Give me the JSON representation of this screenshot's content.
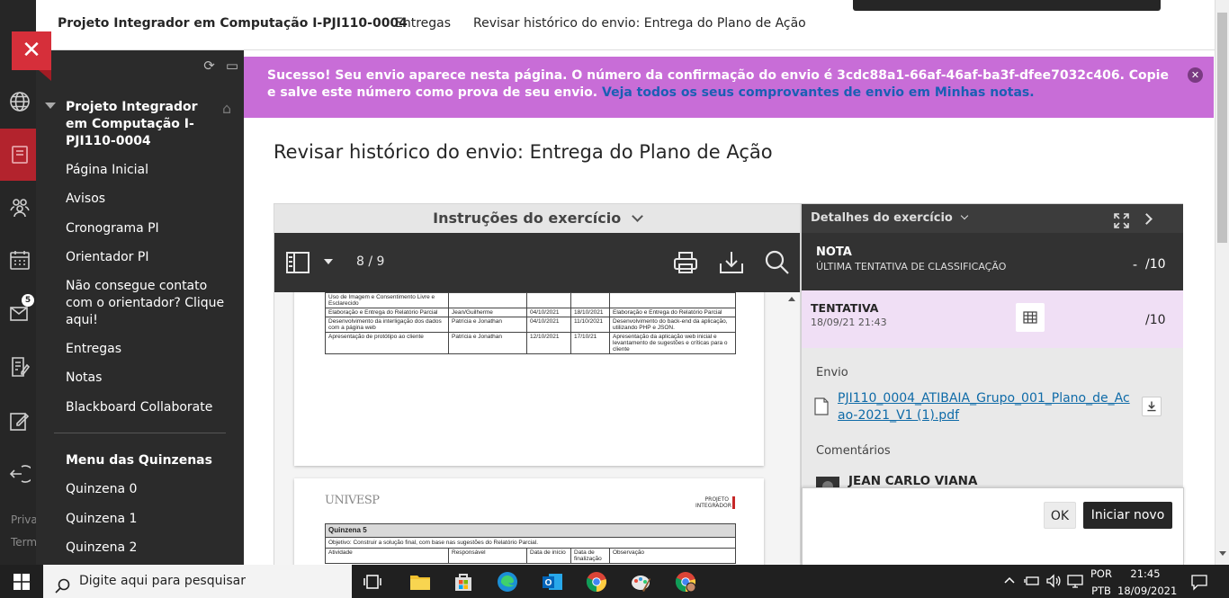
{
  "header": {
    "course": "Projeto Integrador em Computação I-PJI110-0004",
    "crumb_deliveries": "Entregas",
    "crumb_current": "Revisar histórico do envio: Entrega do Plano de Ação"
  },
  "rail": {
    "footer_1": "Priva",
    "footer_2": "Term",
    "mail_badge": "5"
  },
  "sidebar": {
    "course_title": "Projeto Integrador em Computação I-PJI110-0004",
    "items": [
      "Página Inicial",
      "Avisos",
      "Cronograma PI",
      "Orientador PI",
      "Não consegue contato com o orientador? Clique aqui!",
      "Entregas",
      "Notas",
      "Blackboard Collaborate"
    ],
    "section_title": "Menu das Quinzenas",
    "section_items": [
      "Quinzena 0",
      "Quinzena 1",
      "Quinzena 2"
    ]
  },
  "banner": {
    "text": "Sucesso! Seu envio aparece nesta página. O número da confirmação do envio é 3cdc88a1-66af-46af-ba3f-dfee7032c406. Copie e salve este número como prova de seu envio. ",
    "link": "Veja todos os seus comprovantes de envio em Minhas notas."
  },
  "page": {
    "title": "Revisar histórico do envio: Entrega do Plano de Ação"
  },
  "instructions": {
    "header": "Instruções do exercício"
  },
  "pdf": {
    "page_indicator": "8 / 9",
    "rows_top": [
      [
        "Uso de Imagem e Consentimento Livre e Esclarecido",
        "",
        "",
        "",
        ""
      ],
      [
        "Elaboração e Entrega do Relatório Parcial",
        "Jean/Guilherme",
        "04/10/2021",
        "18/10/2021",
        "Elaboração e Entrega do Relatório Parcial"
      ],
      [
        "Desenvolvimento da interligação dos dados com a página web",
        "Patrícia e Jonathan",
        "04/10/2021",
        "11/10/2021",
        "Desenvolvimento do back-end da aplicação, utilizando PHP e JSON."
      ],
      [
        "Apresentação de protótipo ao cliente",
        "Patrícia e Jonathan",
        "12/10/2021",
        "17/10/21",
        "Apresentação da aplicação web inicial e levantamento de sugestões e críticas para o cliente"
      ]
    ],
    "logo": "UNIVESP",
    "logo_right": "PROJETO INTEGRADOR",
    "q_title": "Quinzena 5",
    "q_objective": "Objetivo: Construir a solução final, com base nas sugestões do Relatório Parcial.",
    "q_col_activity": "Atividade",
    "q_col_responsible": "Responsável",
    "q_col_start": "Data de início",
    "q_col_end": "Data de finalização",
    "q_col_obs": "Observação"
  },
  "details": {
    "header": "Detalhes do exercício",
    "grade_label": "NOTA",
    "grade_sub": "ÚLTIMA TENTATIVA DE CLASSIFICAÇÃO",
    "grade_dash": "-",
    "grade_max": "/10",
    "attempt_label": "TENTATIVA",
    "attempt_date": "18/09/21 21:43",
    "attempt_max": "/10",
    "submission_label": "Envio",
    "file_name": "PJI110_0004_ATIBAIA_Grupo_001_Plano_de_Acao-2021_V1 (1).pdf",
    "comments_label": "Comentários",
    "commenter": "JEAN CARLO VIANA",
    "ok_button": "OK",
    "new_button": "Iniciar novo"
  },
  "taskbar": {
    "search_placeholder": "Digite aqui para pesquisar",
    "lang_1": "POR",
    "lang_2": "PTB",
    "time": "21:45",
    "date": "18/09/2021"
  },
  "colors": {
    "banner": "#c86dd7",
    "close_button": "#d62f3a",
    "sidebar": "#2b2b2b",
    "primary_button": "#262626"
  }
}
